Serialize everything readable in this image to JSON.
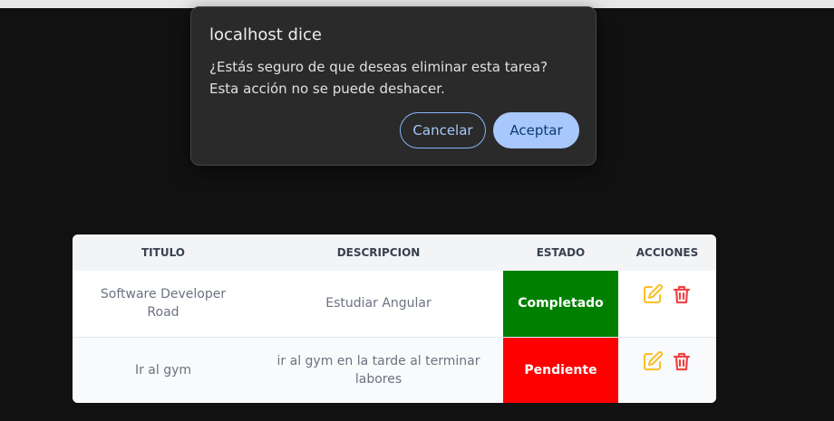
{
  "dialog": {
    "title": "localhost dice",
    "message": "¿Estás seguro de que deseas eliminar esta tarea? Esta acción no se puede deshacer.",
    "cancel_label": "Cancelar",
    "accept_label": "Aceptar"
  },
  "table": {
    "headers": {
      "title": "TITULO",
      "description": "DESCRIPCION",
      "status": "ESTADO",
      "actions": "ACCIONES"
    },
    "rows": [
      {
        "title": "Software Developer Road",
        "description": "Estudiar Angular",
        "status": "Completado",
        "status_color": "#008000",
        "edit_icon": "edit-icon",
        "delete_icon": "trash-icon"
      },
      {
        "title": "Ir al gym",
        "description": "ir al gym en la tarde al terminar labores",
        "status": "Pendiente",
        "status_color": "#ff0000",
        "edit_icon": "edit-icon",
        "delete_icon": "trash-icon"
      }
    ]
  },
  "colors": {
    "edit_icon": "#fbbf24",
    "delete_icon": "#ef4444",
    "dialog_accent": "#a8c7fa"
  }
}
